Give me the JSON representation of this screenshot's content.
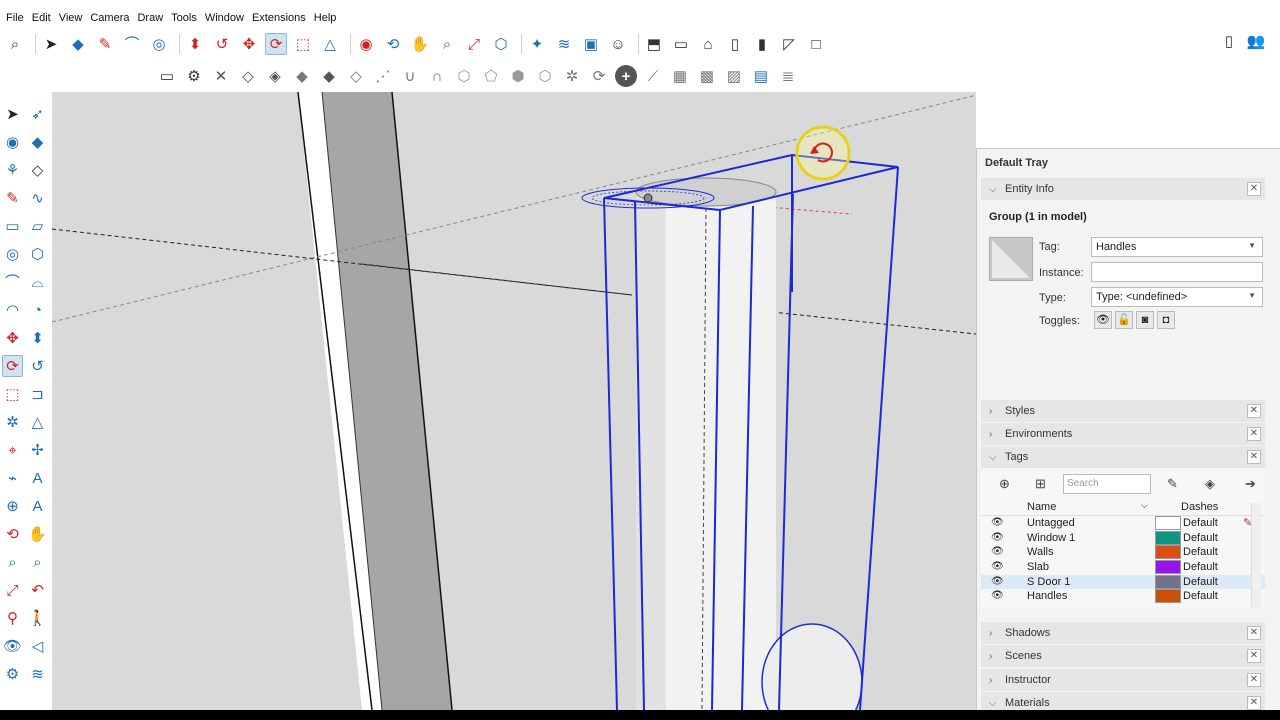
{
  "menu": [
    "File",
    "Edit",
    "View",
    "Camera",
    "Draw",
    "Tools",
    "Window",
    "Extensions",
    "Help"
  ],
  "toolbar_top": [
    {
      "icon": "search-icon",
      "glyph": "⌕",
      "color": "#333"
    },
    {
      "icon": "select-arrow-icon",
      "glyph": "➤",
      "color": "#223"
    },
    {
      "icon": "eraser-icon",
      "glyph": "◆",
      "color": "#1f6fb5"
    },
    {
      "icon": "pencil-icon",
      "glyph": "✎",
      "color": "#d62020"
    },
    {
      "icon": "arc-icon",
      "glyph": "⌒",
      "color": "#1f6fb5"
    },
    {
      "icon": "circle-icon",
      "glyph": "◎",
      "color": "#1f6fb5"
    },
    {
      "icon": "push-pull-icon",
      "glyph": "⬍",
      "color": "#d62020"
    },
    {
      "icon": "follow-me-icon",
      "glyph": "↺",
      "color": "#d62020"
    },
    {
      "icon": "move-icon",
      "glyph": "✥",
      "color": "#d62020"
    },
    {
      "icon": "rotate-icon",
      "glyph": "⟳",
      "color": "#d62020"
    },
    {
      "icon": "scale-icon",
      "glyph": "⬚",
      "color": "#d62020"
    },
    {
      "icon": "protractor-icon",
      "glyph": "△",
      "color": "#1f6fb5"
    },
    {
      "icon": "paint-bucket-icon",
      "glyph": "◉",
      "color": "#d62020"
    },
    {
      "icon": "orbit-icon",
      "glyph": "⟲",
      "color": "#1f6fb5"
    },
    {
      "icon": "pan-icon",
      "glyph": "✋",
      "color": "#d62020"
    },
    {
      "icon": "zoom-icon",
      "glyph": "⌕",
      "color": "#1f6fb5"
    },
    {
      "icon": "zoom-extents-icon",
      "glyph": "⤢",
      "color": "#d62020"
    },
    {
      "icon": "warehouse-icon",
      "glyph": "⬡",
      "color": "#1f6fb5"
    },
    {
      "icon": "extension-icon",
      "glyph": "✦",
      "color": "#1f6fb5"
    },
    {
      "icon": "layers-icon",
      "glyph": "≋",
      "color": "#1f6fb5"
    },
    {
      "icon": "chat-icon",
      "glyph": "▣",
      "color": "#1f6fb5"
    },
    {
      "icon": "profile-icon",
      "glyph": "☺",
      "color": "#333"
    },
    {
      "icon": "iso-view-icon",
      "glyph": "⬒",
      "color": "#333"
    },
    {
      "icon": "top-view-icon",
      "glyph": "▭",
      "color": "#333"
    },
    {
      "icon": "front-view-icon",
      "glyph": "⌂",
      "color": "#333"
    },
    {
      "icon": "right-view-icon",
      "glyph": "▯",
      "color": "#333"
    },
    {
      "icon": "back-view-icon",
      "glyph": "▮",
      "color": "#333"
    },
    {
      "icon": "left-view-icon",
      "glyph": "◸",
      "color": "#333"
    },
    {
      "icon": "bottom-view-icon",
      "glyph": "□",
      "color": "#333"
    }
  ],
  "toolbar_right": [
    {
      "icon": "new-file-icon",
      "glyph": "▯",
      "color": "#333"
    },
    {
      "icon": "account-icon",
      "glyph": "👥",
      "color": "#1f6fb5"
    }
  ],
  "toolbar_second": [
    {
      "icon": "folder-icon",
      "glyph": "▭",
      "color": "#333"
    },
    {
      "icon": "settings-icon",
      "glyph": "⚙",
      "color": "#333"
    },
    {
      "icon": "cross-icon",
      "glyph": "✕",
      "color": "#555"
    },
    {
      "icon": "drop-outline-icon",
      "glyph": "◇",
      "color": "#555"
    },
    {
      "icon": "drop-half-icon",
      "glyph": "◈",
      "color": "#555"
    },
    {
      "icon": "drop-fill-icon",
      "glyph": "◆",
      "color": "#777"
    },
    {
      "icon": "drop-dark-icon",
      "glyph": "◆",
      "color": "#555"
    },
    {
      "icon": "drop-hatch-icon",
      "glyph": "◇",
      "color": "#777"
    },
    {
      "icon": "dots-icon",
      "glyph": "⋰",
      "color": "#777"
    },
    {
      "icon": "magnet-icon",
      "glyph": "∪",
      "color": "#777"
    },
    {
      "icon": "magnet-alt-icon",
      "glyph": "∩",
      "color": "#777"
    },
    {
      "icon": "solid-union-icon",
      "glyph": "⬡",
      "color": "#999"
    },
    {
      "icon": "solid-subtract-icon",
      "glyph": "⬠",
      "color": "#999"
    },
    {
      "icon": "solid-intersect-icon",
      "glyph": "⬢",
      "color": "#999"
    },
    {
      "icon": "solid-trim-icon",
      "glyph": "⬡",
      "color": "#999"
    },
    {
      "icon": "explode-icon",
      "glyph": "✲",
      "color": "#777"
    },
    {
      "icon": "refresh-icon",
      "glyph": "⟳",
      "color": "#777"
    },
    {
      "icon": "add-circle-icon",
      "glyph": "+",
      "color": "#fff"
    },
    {
      "icon": "line-tool-icon",
      "glyph": "⟋",
      "color": "#777"
    },
    {
      "icon": "sandbox-grid-icon",
      "glyph": "▦",
      "color": "#777"
    },
    {
      "icon": "sandbox-mesh-icon",
      "glyph": "▩",
      "color": "#777"
    },
    {
      "icon": "sandbox-drape-icon",
      "glyph": "▨",
      "color": "#777"
    },
    {
      "icon": "sandbox-stamp-icon",
      "glyph": "▤",
      "color": "#1f6fb5"
    },
    {
      "icon": "sandbox-layer-icon",
      "glyph": "≣",
      "color": "#777"
    }
  ],
  "left_tools": [
    [
      {
        "icon": "select-arrow-icon",
        "glyph": "➤",
        "color": "#223"
      },
      {
        "icon": "lasso-icon",
        "glyph": "➶",
        "color": "#1f6fb5"
      }
    ],
    [
      {
        "icon": "paint-bucket-icon",
        "glyph": "◉",
        "color": "#1f6fb5"
      },
      {
        "icon": "eraser-icon",
        "glyph": "◆",
        "color": "#1f6fb5"
      }
    ],
    [
      {
        "icon": "component-icon",
        "glyph": "⚘",
        "color": "#1f6fb5"
      },
      {
        "icon": "tag-icon",
        "glyph": "◇",
        "color": "#333"
      }
    ],
    [
      {
        "icon": "pencil-icon",
        "glyph": "✎",
        "color": "#d62020"
      },
      {
        "icon": "freehand-icon",
        "glyph": "∿",
        "color": "#1f6fb5"
      }
    ],
    [
      {
        "icon": "rectangle-icon",
        "glyph": "▭",
        "color": "#1f6fb5"
      },
      {
        "icon": "rotated-rect-icon",
        "glyph": "▱",
        "color": "#1f6fb5"
      }
    ],
    [
      {
        "icon": "circle-icon",
        "glyph": "◎",
        "color": "#1f6fb5"
      },
      {
        "icon": "polygon-icon",
        "glyph": "⬡",
        "color": "#1f6fb5"
      }
    ],
    [
      {
        "icon": "arc-icon",
        "glyph": "⌒",
        "color": "#1f6fb5"
      },
      {
        "icon": "two-point-arc-icon",
        "glyph": "⌓",
        "color": "#1f6fb5"
      }
    ],
    [
      {
        "icon": "three-point-arc-icon",
        "glyph": "◠",
        "color": "#1f6fb5"
      },
      {
        "icon": "pie-icon",
        "glyph": "◔",
        "color": "#1f6fb5"
      }
    ],
    [
      {
        "icon": "move-icon",
        "glyph": "✥",
        "color": "#d62020"
      },
      {
        "icon": "push-pull-icon",
        "glyph": "⬍",
        "color": "#1f6fb5"
      }
    ],
    [
      {
        "icon": "rotate-icon",
        "glyph": "⟳",
        "color": "#d62020"
      },
      {
        "icon": "follow-me-icon",
        "glyph": "↺",
        "color": "#1f6fb5"
      }
    ],
    [
      {
        "icon": "scale-icon",
        "glyph": "⬚",
        "color": "#d62020"
      },
      {
        "icon": "offset-icon",
        "glyph": "⊐",
        "color": "#1f6fb5"
      }
    ],
    [
      {
        "icon": "tape-measure-icon",
        "glyph": "✲",
        "color": "#1f6fb5"
      },
      {
        "icon": "protractor-icon",
        "glyph": "△",
        "color": "#1f6fb5"
      }
    ],
    [
      {
        "icon": "dimension-icon",
        "glyph": "⌖",
        "color": "#d62020"
      },
      {
        "icon": "axes-icon",
        "glyph": "✢",
        "color": "#1f6fb5"
      }
    ],
    [
      {
        "icon": "text-icon",
        "glyph": "⌁",
        "color": "#1f6fb5"
      },
      {
        "icon": "label-icon",
        "glyph": "A",
        "color": "#1f6fb5"
      }
    ],
    [
      {
        "icon": "section-plane-icon",
        "glyph": "⊕",
        "color": "#1f6fb5"
      },
      {
        "icon": "3d-text-icon",
        "glyph": "A",
        "color": "#1f6fb5"
      }
    ],
    [
      {
        "icon": "orbit-icon",
        "glyph": "⟲",
        "color": "#d62020"
      },
      {
        "icon": "pan-icon",
        "glyph": "✋",
        "color": "#d62020"
      }
    ],
    [
      {
        "icon": "zoom-icon",
        "glyph": "⌕",
        "color": "#1f6fb5"
      },
      {
        "icon": "zoom-window-icon",
        "glyph": "⌕",
        "color": "#1f6fb5"
      }
    ],
    [
      {
        "icon": "zoom-extents-icon",
        "glyph": "⤢",
        "color": "#d62020"
      },
      {
        "icon": "previous-view-icon",
        "glyph": "↶",
        "color": "#d62020"
      }
    ],
    [
      {
        "icon": "position-camera-icon",
        "glyph": "⚲",
        "color": "#d62020"
      },
      {
        "icon": "walk-icon",
        "glyph": "🚶",
        "color": "#1f6fb5"
      }
    ],
    [
      {
        "icon": "look-around-icon",
        "glyph": "👁",
        "color": "#1f6fb5"
      },
      {
        "icon": "speaker-icon",
        "glyph": "◁",
        "color": "#1f6fb5"
      }
    ],
    [
      {
        "icon": "gear-settings-icon",
        "glyph": "⚙",
        "color": "#1f6fb5"
      },
      {
        "icon": "sandbox-icon",
        "glyph": "≋",
        "color": "#1f6fb5"
      }
    ]
  ],
  "tray": {
    "title": "Default Tray",
    "entity_info": {
      "panel_label": "Entity Info",
      "heading": "Group (1 in model)",
      "tag_label": "Tag:",
      "tag_value": "Handles",
      "instance_label": "Instance:",
      "instance_value": "",
      "type_label": "Type:",
      "type_value": "Type: <undefined>",
      "toggles_label": "Toggles:"
    },
    "panels": [
      "Styles",
      "Environments",
      "Tags",
      "Shadows",
      "Scenes",
      "Instructor",
      "Materials"
    ],
    "tags": {
      "search_placeholder": "Search",
      "col_name": "Name",
      "col_dashes": "Dashes",
      "rows": [
        {
          "name": "Untagged",
          "color": "#ffffff",
          "dashes": "Default"
        },
        {
          "name": "Window 1",
          "color": "#0f9480",
          "dashes": "Default"
        },
        {
          "name": "Walls",
          "color": "#d94f0f",
          "dashes": "Default"
        },
        {
          "name": "Slab",
          "color": "#9a12e8",
          "dashes": "Default"
        },
        {
          "name": "S Door 1",
          "color": "#74718e",
          "dashes": "Default"
        },
        {
          "name": "Handles",
          "color": "#c9510c",
          "dashes": "Default"
        }
      ]
    }
  }
}
